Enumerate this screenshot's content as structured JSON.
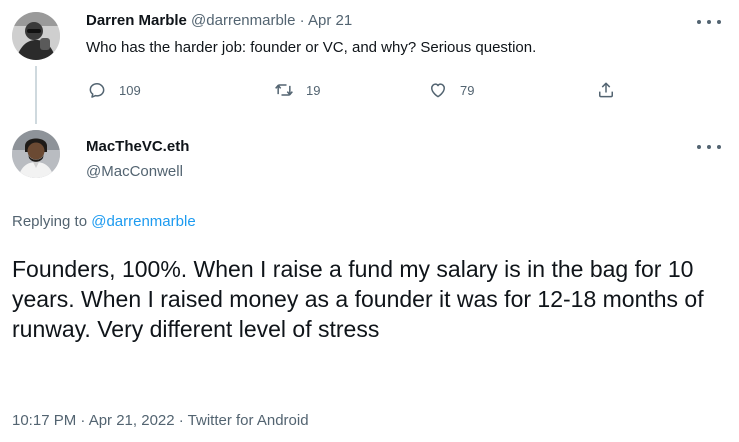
{
  "parent_tweet": {
    "author_name": "Darren Marble",
    "handle": "@darrenmarble",
    "separator": "·",
    "date": "Apr 21",
    "text": "Who has the harder job: founder or VC, and why? Serious question.",
    "counts": {
      "replies": "109",
      "retweets": "19",
      "likes": "79"
    }
  },
  "main_tweet": {
    "author_name": "MacTheVC.eth",
    "handle": "@MacConwell",
    "replying_prefix": "Replying to",
    "replying_to": "@darrenmarble",
    "text": "Founders, 100%. When I raise a fund my salary is in the bag for 10 years. When I raised money as a founder it was for 12-18 months of runway. Very different level of stress",
    "meta": "10:17 PM · Apr 21, 2022 · Twitter for Android"
  },
  "icons": {
    "reply": "reply-icon",
    "retweet": "retweet-icon",
    "like": "heart-icon",
    "share": "share-icon",
    "more": "more-icon"
  },
  "colors": {
    "link": "#1d9bf0",
    "muted": "#536471",
    "text": "#0f1419"
  }
}
